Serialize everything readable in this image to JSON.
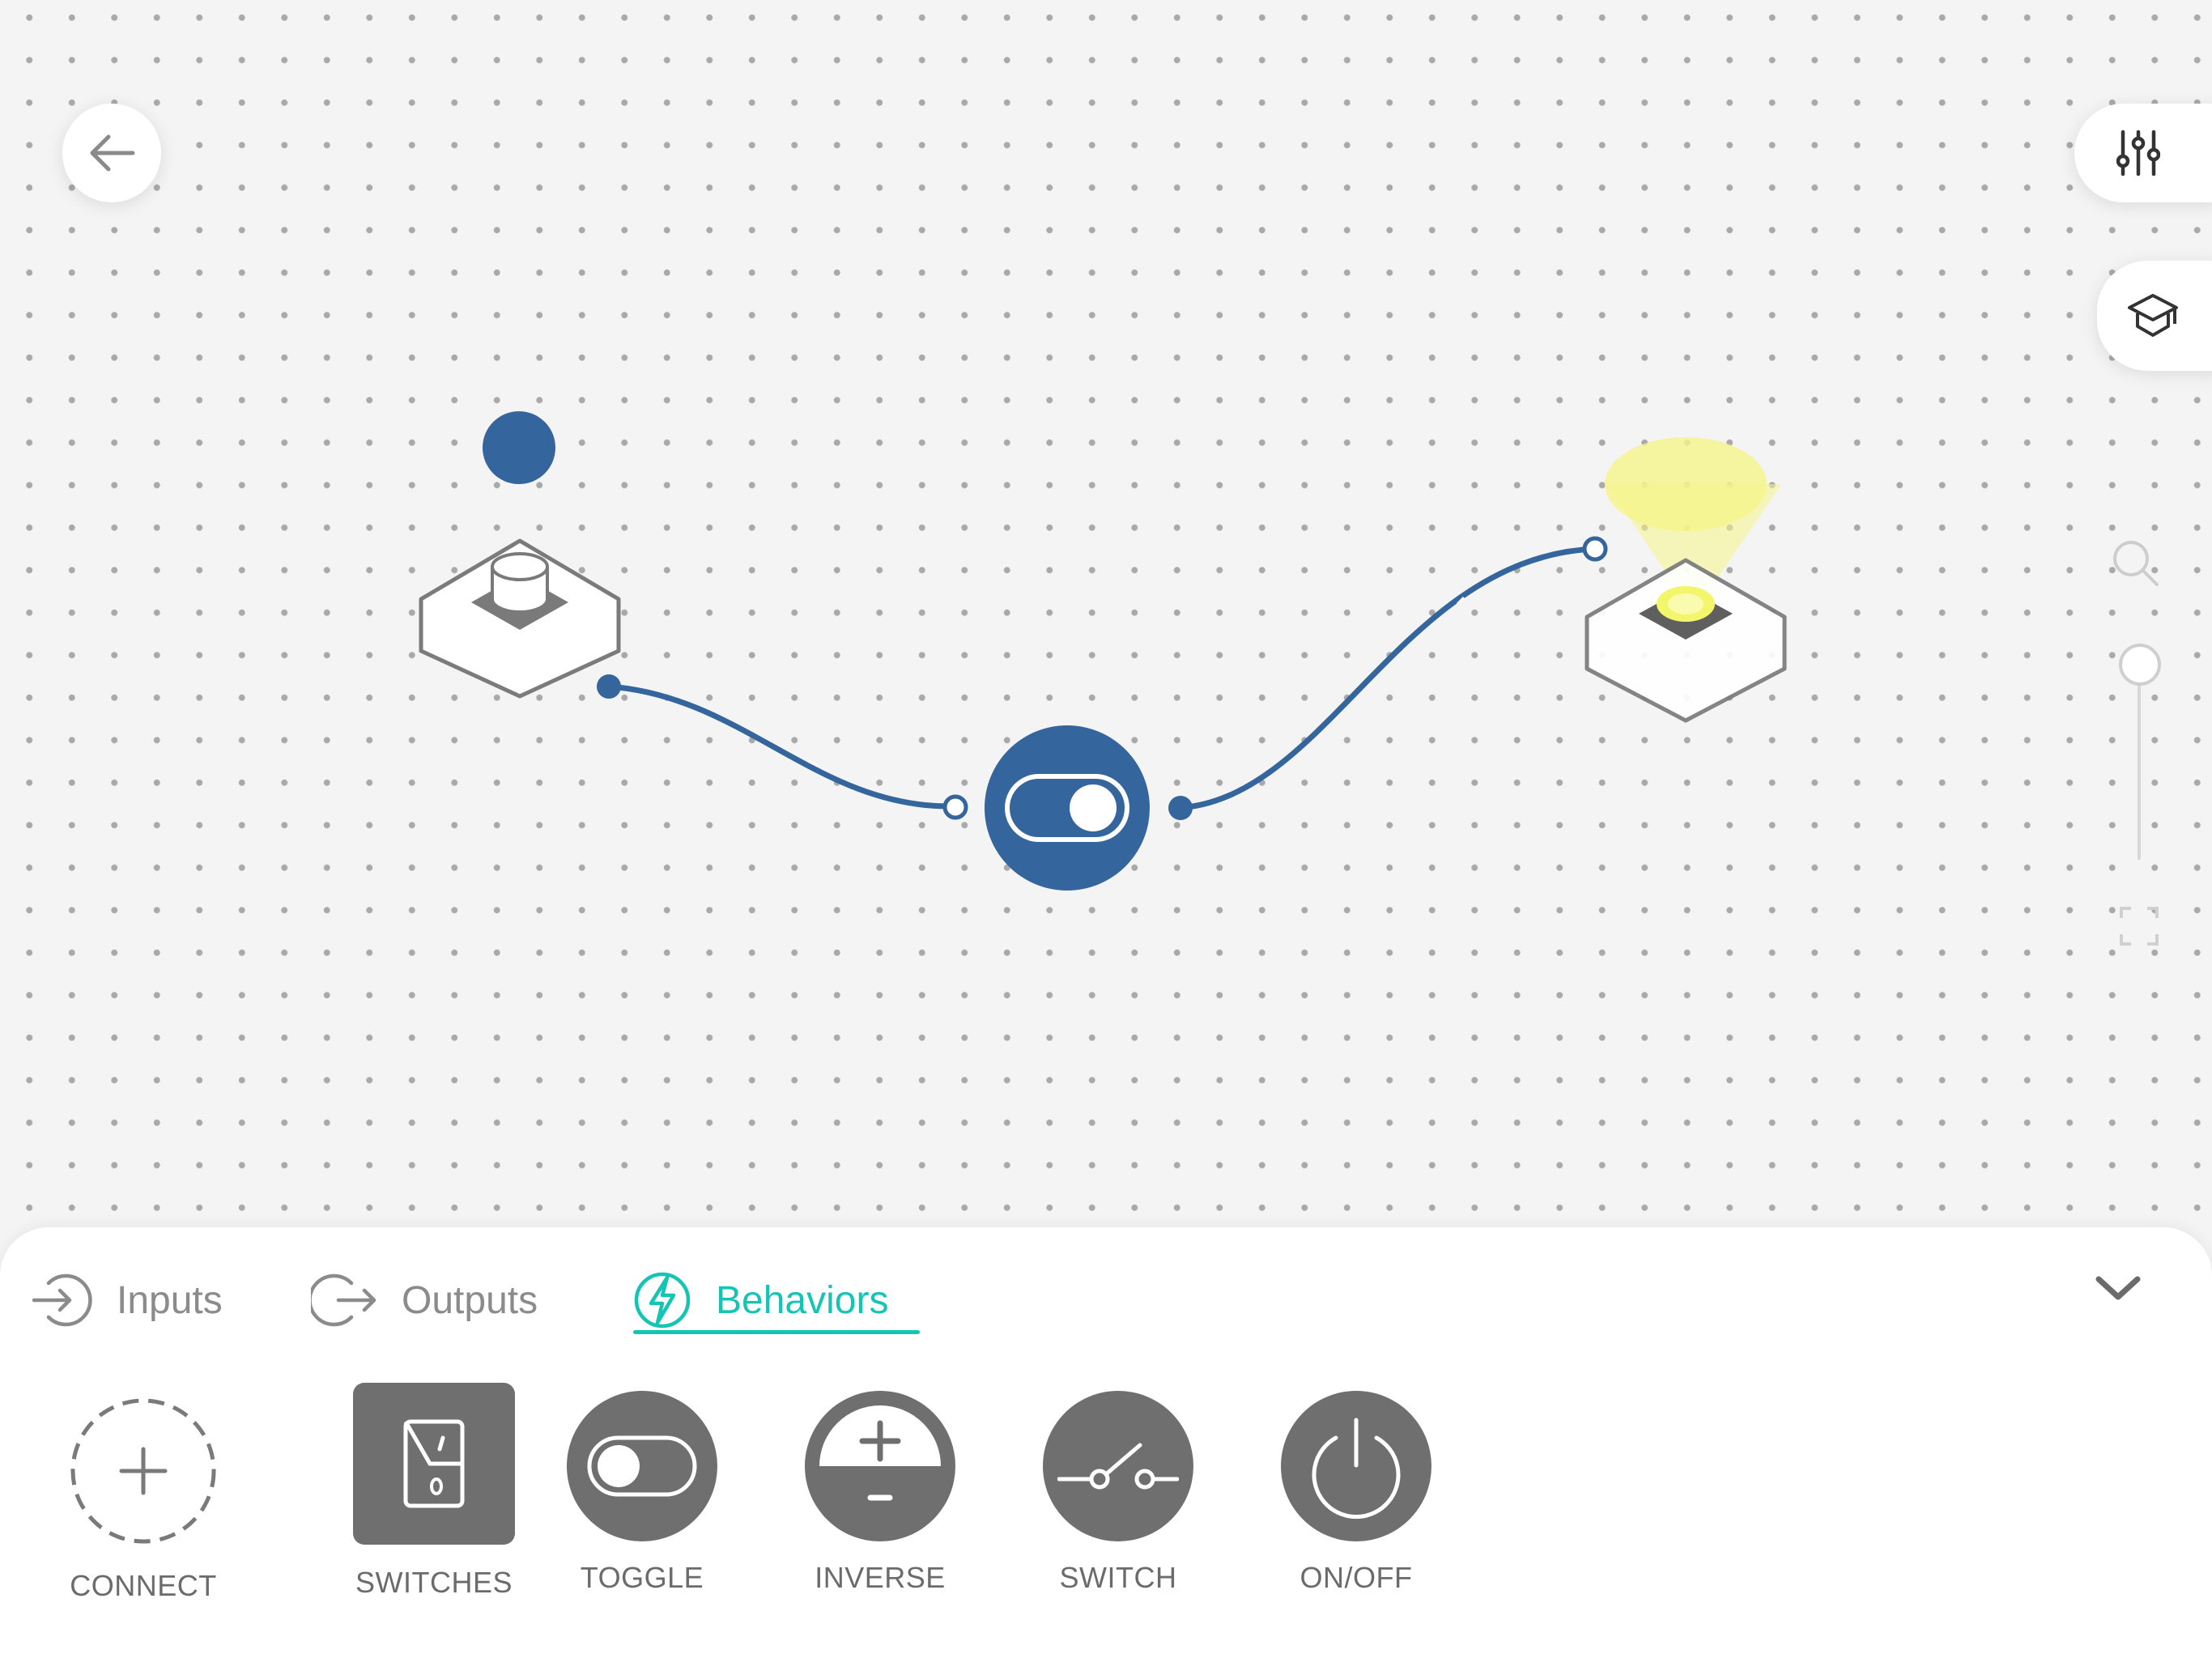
{
  "toolbar": {
    "back": {
      "icon": "arrow-left-icon"
    },
    "settings": {
      "icon": "sliders-icon"
    },
    "learn": {
      "icon": "graduation-cap-icon"
    }
  },
  "zoom_controls": {
    "search_icon": "magnifier-icon",
    "fit_icon": "fullscreen-icon",
    "zoom_level": 1.0
  },
  "canvas": {
    "nodes": [
      {
        "id": "push-button",
        "type": "input",
        "state": "pressed"
      },
      {
        "id": "toggle-behavior",
        "type": "behavior",
        "state": "on"
      },
      {
        "id": "light",
        "type": "output",
        "state": "lit"
      }
    ],
    "wires": [
      {
        "from": "push-button",
        "to": "toggle-behavior"
      },
      {
        "from": "toggle-behavior",
        "to": "light"
      }
    ]
  },
  "tabs": [
    {
      "label": "Inputs",
      "icon": "input-arrow-icon",
      "active": false
    },
    {
      "label": "Outputs",
      "icon": "output-arrow-icon",
      "active": false
    },
    {
      "label": "Behaviors",
      "icon": "lightning-icon",
      "active": true
    }
  ],
  "palette": {
    "connect": {
      "label": "CONNECT",
      "icon": "plus-icon"
    },
    "items": [
      {
        "label": "SWITCHES",
        "icon": "rocker-switch-icon",
        "selected": true
      },
      {
        "label": "TOGGLE",
        "icon": "toggle-icon"
      },
      {
        "label": "INVERSE",
        "icon": "plus-minus-icon"
      },
      {
        "label": "SWITCH",
        "icon": "circuit-switch-icon"
      },
      {
        "label": "ON/OFF",
        "icon": "power-icon"
      }
    ]
  },
  "colors": {
    "accent": "#16c4b6",
    "wire": "#34659c",
    "node_blue": "#34659c",
    "tile_gray": "#6f6f6f",
    "light_glow": "#f6f58a",
    "light_core": "#f3f56a"
  }
}
